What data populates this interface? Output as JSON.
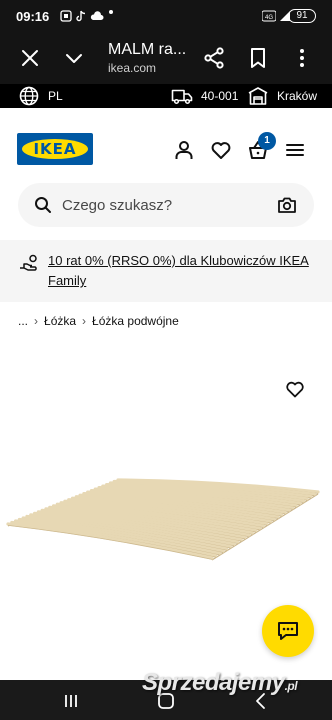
{
  "status_bar": {
    "time": "09:16",
    "battery": "91"
  },
  "browser": {
    "title": "MALM ra...",
    "url": "ikea.com"
  },
  "top_strip": {
    "language": "PL",
    "postal_code": "40-001",
    "store": "Kraków"
  },
  "header": {
    "logo_text": "IKEA",
    "cart_count": "1"
  },
  "search": {
    "placeholder": "Czego szukasz?"
  },
  "promo": {
    "text": "10 rat 0% (RRSO 0%) dla Klubowiczów IKEA Family"
  },
  "breadcrumb": {
    "ellipsis": "...",
    "items": [
      "Łóżka",
      "Łóżka podwójne"
    ]
  },
  "watermark": {
    "text": "Sprzedajemy",
    "suffix": ".pl"
  },
  "colors": {
    "ikea_blue": "#0058a3",
    "ikea_yellow": "#ffdb00",
    "dark_bar": "#141414"
  }
}
